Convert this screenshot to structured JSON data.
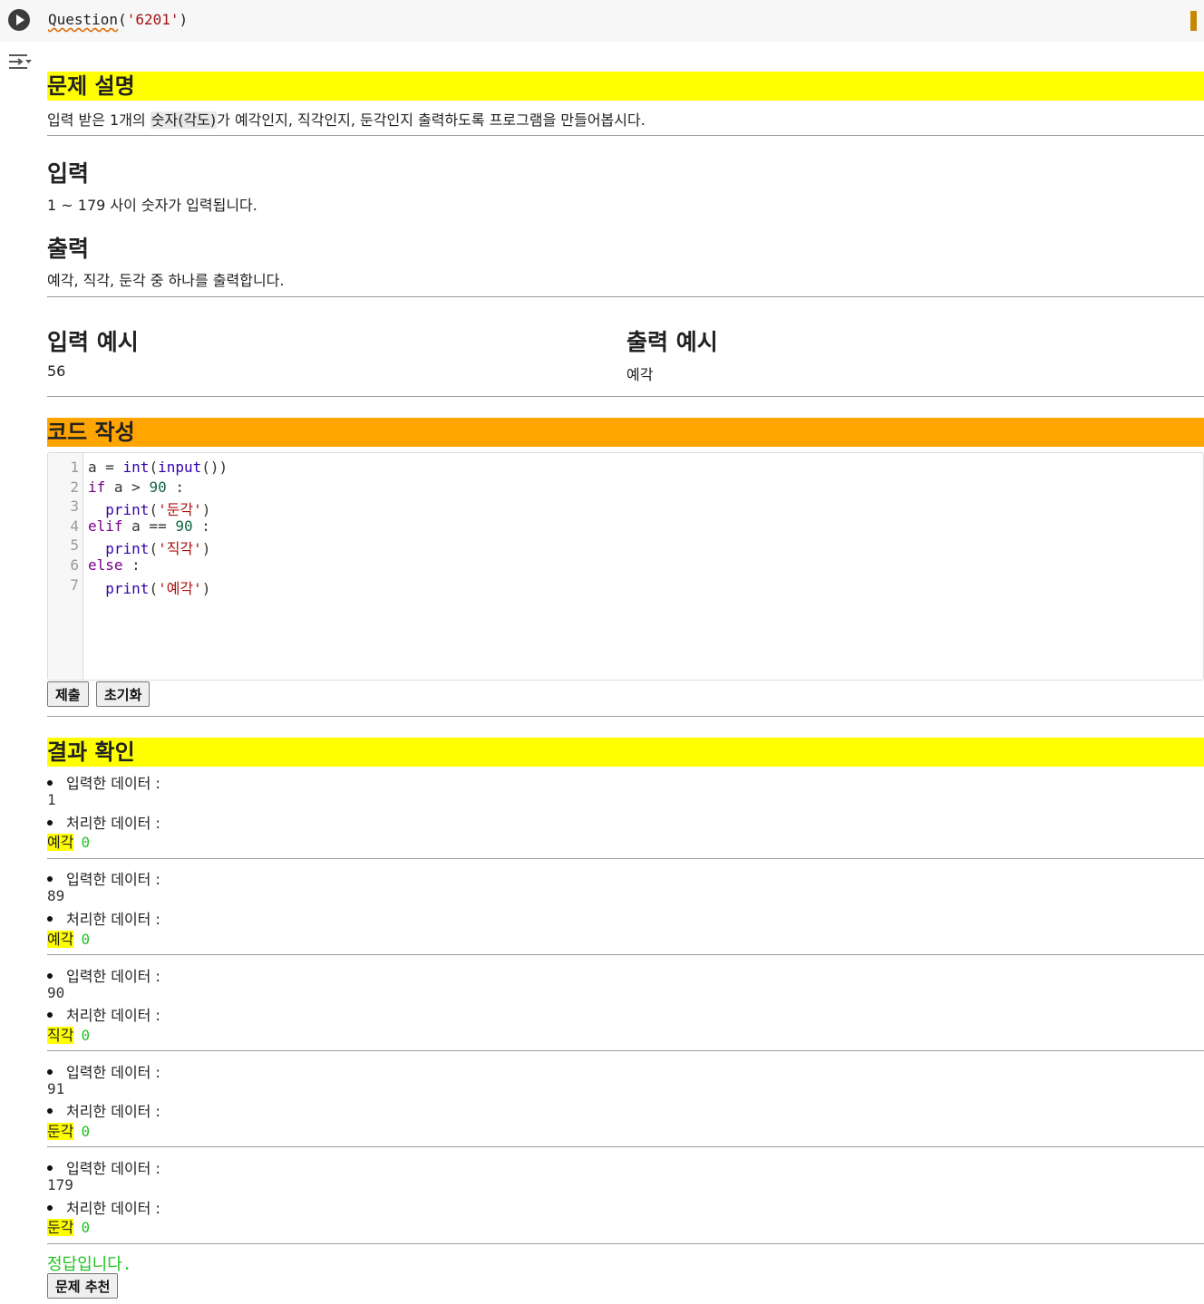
{
  "cell": {
    "code_fn": "Question",
    "code_open": "(",
    "code_arg": "'6201'",
    "code_close": ")"
  },
  "problem": {
    "title": "문제 설명",
    "desc_before": "입력 받은 1개의 ",
    "desc_highlight": "숫자(각도)",
    "desc_after": "가 예각인지, 직각인지, 둔각인지 출력하도록 프로그램을 만들어봅시다.",
    "input_heading": "입력",
    "input_text": "1 ~ 179 사이 숫자가 입력됩니다.",
    "output_heading": "출력",
    "output_text": "예각, 직각, 둔각 중 하나를 출력합니다.",
    "example_input_heading": "입력 예시",
    "example_input": "56",
    "example_output_heading": "출력 예시",
    "example_output": "예각"
  },
  "editor_section": {
    "title": "코드 작성",
    "line_numbers": [
      "1",
      "2",
      "3",
      "4",
      "5",
      "6",
      "7"
    ],
    "submit_label": "제출",
    "reset_label": "초기화"
  },
  "results": {
    "title": "결과 확인",
    "input_label": "입력한 데이터 :",
    "output_label": "처리한 데이터 :",
    "items": [
      {
        "input": "1",
        "output": "예각",
        "score": "0"
      },
      {
        "input": "89",
        "output": "예각",
        "score": "0"
      },
      {
        "input": "90",
        "output": "직각",
        "score": "0"
      },
      {
        "input": "91",
        "output": "둔각",
        "score": "0"
      },
      {
        "input": "179",
        "output": "둔각",
        "score": "0"
      }
    ],
    "correct_message": "정답입니다.",
    "recommend_label": "문제 추천"
  },
  "icons": {
    "run": "play-circle-icon",
    "output_toggle": "output-settings-icon"
  }
}
